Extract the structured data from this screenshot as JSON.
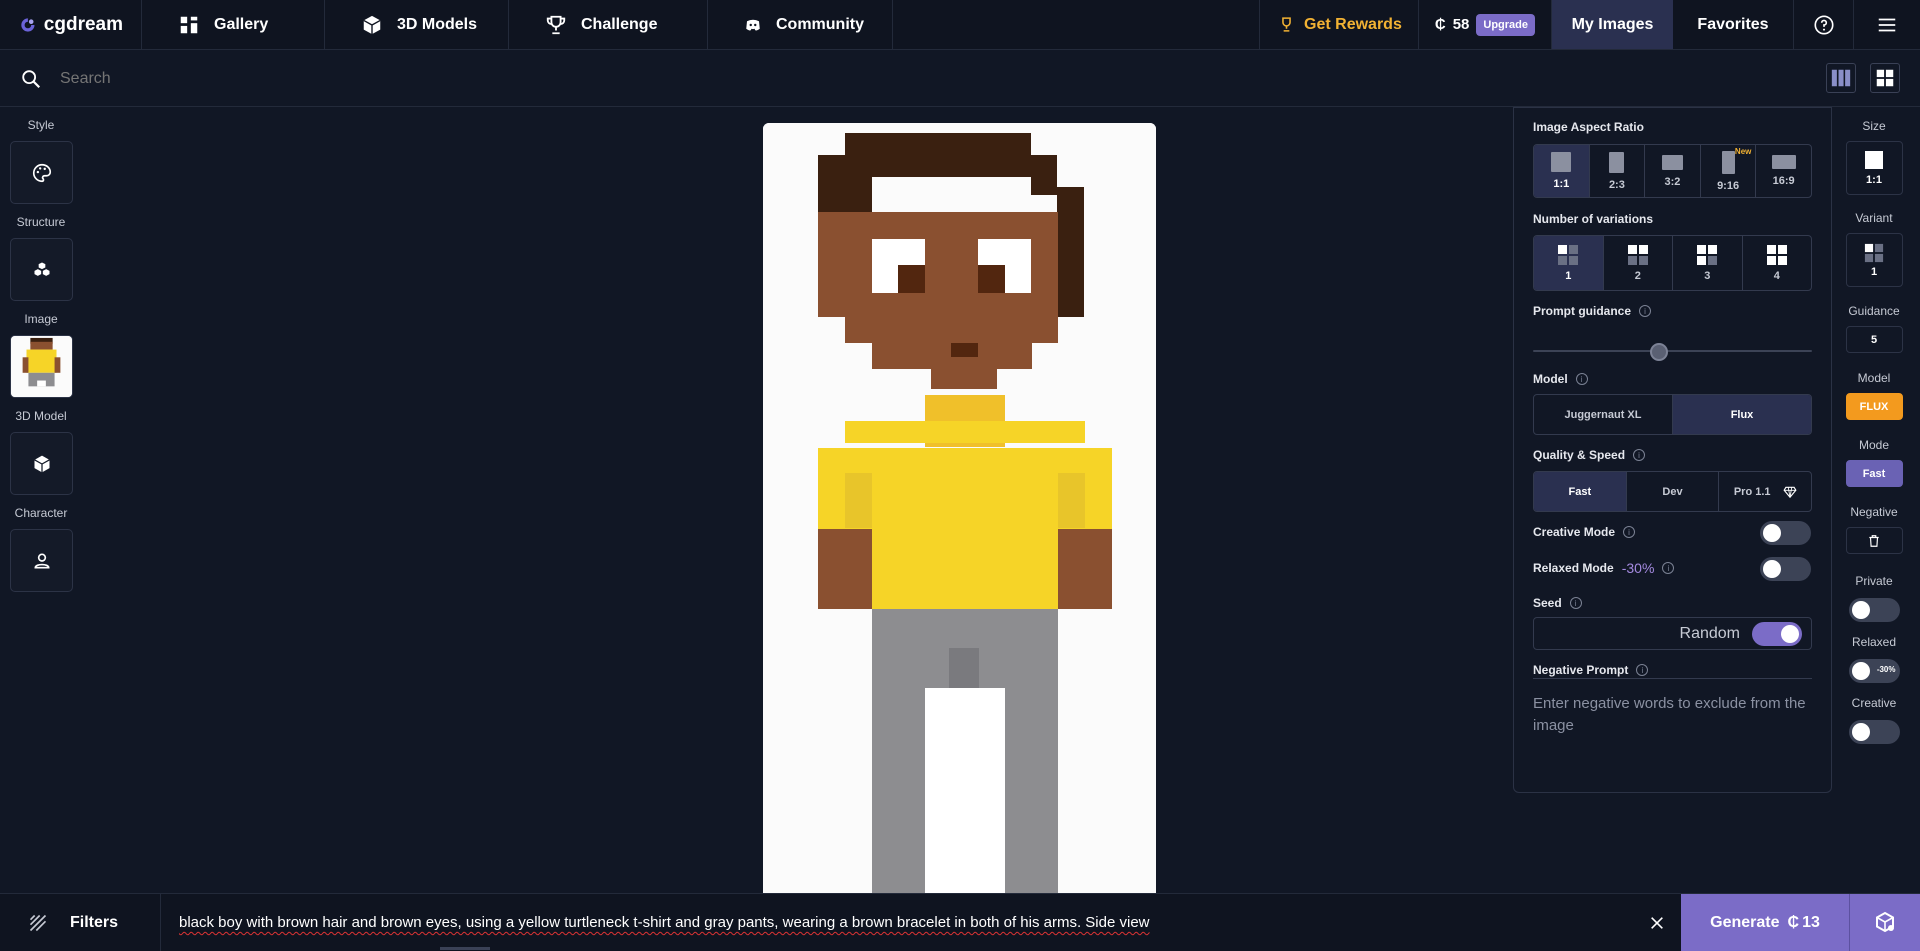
{
  "nav": {
    "brand": "cgdream",
    "items": [
      "Gallery",
      "3D Models",
      "Challenge",
      "Community"
    ],
    "rewards": "Get Rewards",
    "credits": "58",
    "upgrade": "Upgrade",
    "my_images": "My Images",
    "favorites": "Favorites"
  },
  "search": {
    "placeholder": "Search"
  },
  "left_sidebar": {
    "style": "Style",
    "structure": "Structure",
    "image": "Image",
    "model3d": "3D Model",
    "character": "Character"
  },
  "panel": {
    "aspect_label": "Image Aspect Ratio",
    "aspect_options": [
      "1:1",
      "2:3",
      "3:2",
      "9:16",
      "16:9"
    ],
    "aspect_new_tag": "New",
    "variations_label": "Number of variations",
    "variation_options": [
      "1",
      "2",
      "3",
      "4"
    ],
    "guidance_label": "Prompt guidance",
    "guidance_level": 0.45,
    "model_label": "Model",
    "model_options": [
      "Juggernaut XL",
      "Flux"
    ],
    "quality_label": "Quality & Speed",
    "quality_options": [
      "Fast",
      "Dev",
      "Pro 1.1"
    ],
    "creative_label": "Creative Mode",
    "relaxed_label": "Relaxed Mode",
    "relaxed_discount": "-30%",
    "seed_label": "Seed",
    "seed_value": "Random",
    "negative_label": "Negative Prompt",
    "negative_placeholder": "Enter negative words to exclude from the image"
  },
  "mini": {
    "size_label": "Size",
    "size_value": "1:1",
    "variant_label": "Variant",
    "variant_value": "1",
    "guidance_label": "Guidance",
    "guidance_value": "5",
    "model_label": "Model",
    "model_value": "FLUX",
    "mode_label": "Mode",
    "mode_value": "Fast",
    "negative_label": "Negative",
    "private_label": "Private",
    "relaxed_label": "Relaxed",
    "relaxed_pct": "-30%",
    "creative_label": "Creative"
  },
  "bottom": {
    "filters": "Filters",
    "prompt": "black boy with brown hair and brown eyes, using a yellow turtleneck t-shirt and gray pants, wearing a brown bracelet in both of his arms. Side view",
    "generate": "Generate",
    "generate_cost": "13"
  },
  "colors": {
    "accent": "#7b6cc7",
    "selected_bg": "#2a3050",
    "rewards": "#f2b233",
    "flux": "#f39a1e"
  }
}
